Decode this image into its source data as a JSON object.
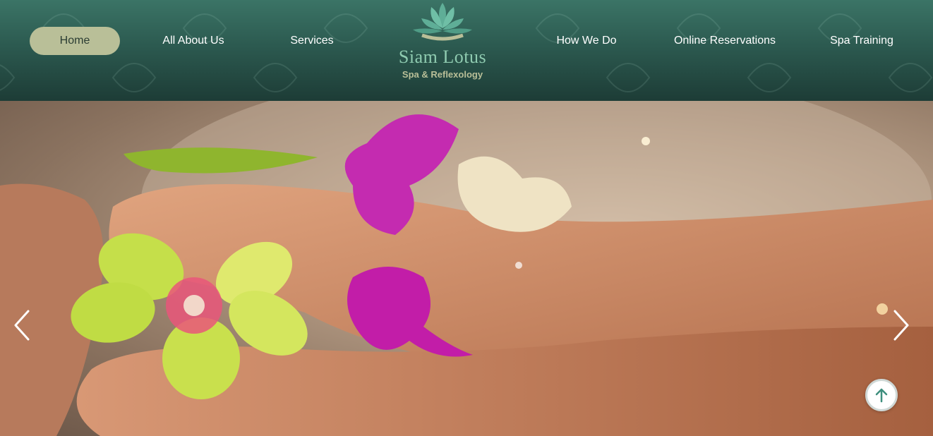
{
  "nav": {
    "left": [
      {
        "label": "Home",
        "active": true
      },
      {
        "label": "All About Us"
      },
      {
        "label": "Services"
      }
    ],
    "right": [
      {
        "label": "How We Do"
      },
      {
        "label": "Online Reservations"
      },
      {
        "label": "Spa Training"
      }
    ]
  },
  "logo": {
    "title": "Siam Lotus",
    "subtitle": "Spa & Reflexology",
    "icon": "lotus-icon"
  },
  "hero": {
    "prev_icon": "chevron-left-icon",
    "next_icon": "chevron-right-icon"
  },
  "scroll_top": {
    "icon": "arrow-up-icon"
  },
  "colors": {
    "header_top": "#3b7466",
    "header_bottom": "#1d3c36",
    "active_pill": "#b9bf98",
    "logo_text": "#8fcbb0",
    "accent": "#3f8f7e"
  }
}
